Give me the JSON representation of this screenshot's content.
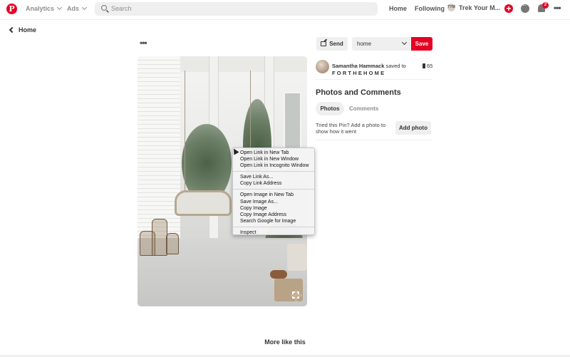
{
  "nav": {
    "logo": "P",
    "analytics": "Analytics",
    "ads": "Ads",
    "search_placeholder": "Search",
    "home": "Home",
    "following": "Following",
    "profile_name": "Trek Your M...",
    "profile_initials": "TYM",
    "notification_count": "2"
  },
  "back_label": "Home",
  "pin": {
    "send_label": "Send",
    "board_select": "home",
    "save_label": "Save",
    "saver_name": "Samantha Hammack",
    "saved_to": "saved to",
    "board_name": "FORTHEHOME",
    "pin_count": "65"
  },
  "context_menu": {
    "group1": [
      "Open Link in New Tab",
      "Open Link in New Window",
      "Open Link in Incognito Window"
    ],
    "group2": [
      "Save Link As...",
      "Copy Link Address"
    ],
    "group3": [
      "Open Image in New Tab",
      "Save Image As...",
      "Copy Image",
      "Copy Image Address",
      "Search Google for Image"
    ],
    "group4": [
      "Inspect"
    ]
  },
  "photos_comments": {
    "title": "Photos and Comments",
    "tab_photos": "Photos",
    "tab_comments": "Comments",
    "tried_text": "Tried this Pin? Add a photo to show how it went",
    "add_photo": "Add photo"
  },
  "more_like_this": "More like this"
}
